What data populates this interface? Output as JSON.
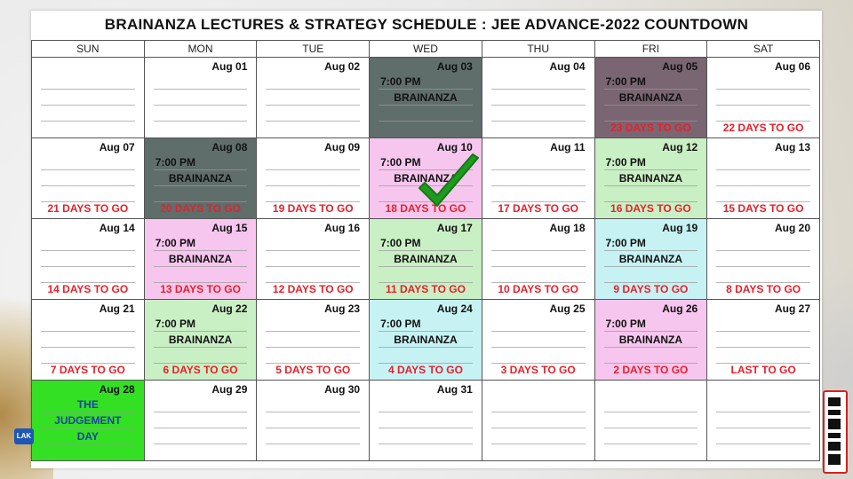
{
  "title": "BRAINANZA LECTURES & STRATEGY SCHEDULE : JEE ADVANCE-2022 COUNTDOWN",
  "days": [
    "SUN",
    "MON",
    "TUE",
    "WED",
    "THU",
    "FRI",
    "SAT"
  ],
  "weeks": [
    [
      {
        "date": "",
        "time": "",
        "event": "",
        "togo": "",
        "color": ""
      },
      {
        "date": "Aug 01",
        "time": "",
        "event": "",
        "togo": "",
        "color": ""
      },
      {
        "date": "Aug 02",
        "time": "",
        "event": "",
        "togo": "",
        "color": ""
      },
      {
        "date": "Aug 03",
        "time": "7:00 PM",
        "event": "BRAINANZA",
        "togo": "",
        "color": "gray"
      },
      {
        "date": "Aug 04",
        "time": "",
        "event": "",
        "togo": "",
        "color": ""
      },
      {
        "date": "Aug 05",
        "time": "7:00 PM",
        "event": "BRAINANZA",
        "togo": "23 DAYS TO GO",
        "color": "purple"
      },
      {
        "date": "Aug 06",
        "time": "",
        "event": "",
        "togo": "22 DAYS TO GO",
        "color": ""
      }
    ],
    [
      {
        "date": "Aug 07",
        "time": "",
        "event": "",
        "togo": "21 DAYS TO GO",
        "color": ""
      },
      {
        "date": "Aug 08",
        "time": "7:00 PM",
        "event": "BRAINANZA",
        "togo": "20 DAYS TO GO",
        "color": "gray"
      },
      {
        "date": "Aug 09",
        "time": "",
        "event": "",
        "togo": "19 DAYS TO GO",
        "color": ""
      },
      {
        "date": "Aug 10",
        "time": "7:00 PM",
        "event": "BRAINANZA",
        "togo": "18 DAYS TO GO",
        "color": "pink"
      },
      {
        "date": "Aug 11",
        "time": "",
        "event": "",
        "togo": "17 DAYS TO GO",
        "color": ""
      },
      {
        "date": "Aug 12",
        "time": "7:00 PM",
        "event": "BRAINANZA",
        "togo": "16 DAYS TO GO",
        "color": "green"
      },
      {
        "date": "Aug 13",
        "time": "",
        "event": "",
        "togo": "15 DAYS TO GO",
        "color": ""
      }
    ],
    [
      {
        "date": "Aug 14",
        "time": "",
        "event": "",
        "togo": "14 DAYS TO GO",
        "color": ""
      },
      {
        "date": "Aug 15",
        "time": "7:00 PM",
        "event": "BRAINANZA",
        "togo": "13 DAYS TO GO",
        "color": "pink"
      },
      {
        "date": "Aug 16",
        "time": "",
        "event": "",
        "togo": "12 DAYS TO GO",
        "color": ""
      },
      {
        "date": "Aug 17",
        "time": "7:00 PM",
        "event": "BRAINANZA",
        "togo": "11 DAYS TO GO",
        "color": "green"
      },
      {
        "date": "Aug 18",
        "time": "",
        "event": "",
        "togo": "10 DAYS TO GO",
        "color": ""
      },
      {
        "date": "Aug 19",
        "time": "7:00 PM",
        "event": "BRAINANZA",
        "togo": "9 DAYS TO GO",
        "color": "cyan"
      },
      {
        "date": "Aug 20",
        "time": "",
        "event": "",
        "togo": "8 DAYS TO GO",
        "color": ""
      }
    ],
    [
      {
        "date": "Aug 21",
        "time": "",
        "event": "",
        "togo": "7 DAYS TO GO",
        "color": ""
      },
      {
        "date": "Aug 22",
        "time": "7:00 PM",
        "event": "BRAINANZA",
        "togo": "6 DAYS TO GO",
        "color": "green"
      },
      {
        "date": "Aug 23",
        "time": "",
        "event": "",
        "togo": "5 DAYS TO GO",
        "color": ""
      },
      {
        "date": "Aug 24",
        "time": "7:00 PM",
        "event": "BRAINANZA",
        "togo": "4 DAYS TO GO",
        "color": "cyan"
      },
      {
        "date": "Aug 25",
        "time": "",
        "event": "",
        "togo": "3 DAYS TO GO",
        "color": ""
      },
      {
        "date": "Aug 26",
        "time": "7:00 PM",
        "event": "BRAINANZA",
        "togo": "2 DAYS TO GO",
        "color": "pink"
      },
      {
        "date": "Aug 27",
        "time": "",
        "event": "",
        "togo": "LAST TO GO",
        "color": ""
      }
    ],
    [
      {
        "date": "Aug 28",
        "time": "",
        "event": "",
        "togo": "",
        "color": "bright",
        "special": [
          "THE",
          "JUDGEMENT",
          "DAY"
        ]
      },
      {
        "date": "Aug 29",
        "time": "",
        "event": "",
        "togo": "",
        "color": ""
      },
      {
        "date": "Aug 30",
        "time": "",
        "event": "",
        "togo": "",
        "color": ""
      },
      {
        "date": "Aug 31",
        "time": "",
        "event": "",
        "togo": "",
        "color": ""
      },
      {
        "date": "",
        "time": "",
        "event": "",
        "togo": "",
        "color": ""
      },
      {
        "date": "",
        "time": "",
        "event": "",
        "togo": "",
        "color": ""
      },
      {
        "date": "",
        "time": "",
        "event": "",
        "togo": "",
        "color": ""
      }
    ]
  ],
  "colors": {
    "gray": "#5f6d6b",
    "purple": "#7a6572",
    "pink": "#f6c6ee",
    "green": "#c9efc4",
    "cyan": "#c6f2f4",
    "bright": "#33e024",
    "togo": "#e8202a",
    "special": "#1f3fa8",
    "check": "#1f9a1f"
  },
  "icons": {
    "completed": "checkmark-icon",
    "logo": "lak-logo-icon",
    "qr": "qr-code-icon"
  },
  "logo_text": "LAK"
}
